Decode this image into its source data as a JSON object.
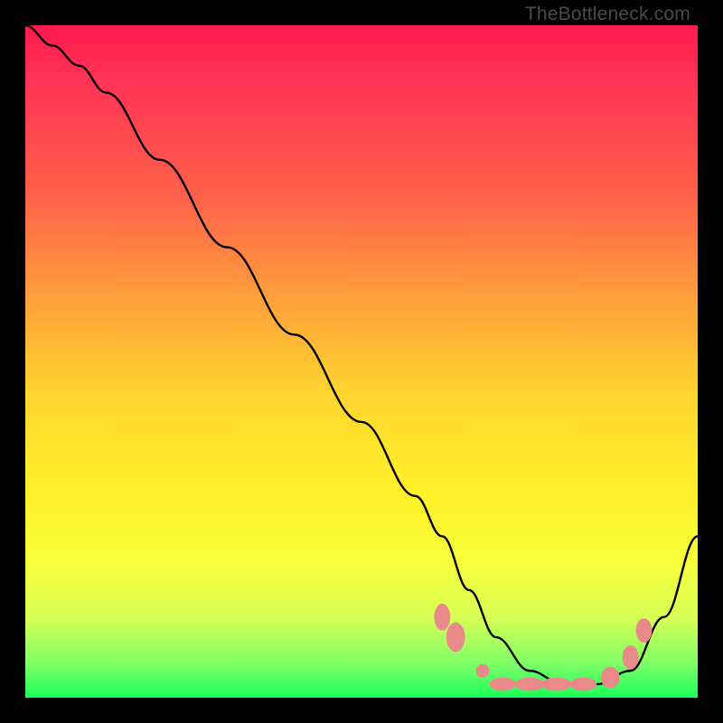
{
  "watermark": "TheBottleneck.com",
  "chart_data": {
    "type": "line",
    "title": "",
    "xlabel": "",
    "ylabel": "",
    "xlim": [
      0,
      100
    ],
    "ylim": [
      0,
      100
    ],
    "grid": false,
    "legend": false,
    "background": {
      "type": "vertical-gradient",
      "stops": [
        {
          "pos": 0,
          "color": "#ff1a4d"
        },
        {
          "pos": 25,
          "color": "#ff5f4a"
        },
        {
          "pos": 55,
          "color": "#ffd52e"
        },
        {
          "pos": 80,
          "color": "#f6ff3a"
        },
        {
          "pos": 100,
          "color": "#1aff5a"
        }
      ]
    },
    "series": [
      {
        "name": "curve",
        "color": "#000000",
        "x": [
          0,
          4,
          8,
          12,
          20,
          30,
          40,
          50,
          58,
          62,
          66,
          70,
          75,
          80,
          85,
          90,
          95,
          100
        ],
        "values": [
          100,
          97,
          94,
          90,
          80,
          67,
          54,
          41,
          30,
          24,
          16,
          9,
          4,
          2,
          2,
          4,
          12,
          24
        ]
      }
    ],
    "markers": [
      {
        "name": "dot-cluster",
        "color": "#e98a8a",
        "shape": "ellipse",
        "points": [
          {
            "x": 62,
            "y": 12,
            "rx": 1.2,
            "ry": 2.0
          },
          {
            "x": 64,
            "y": 9,
            "rx": 1.4,
            "ry": 2.2
          },
          {
            "x": 68,
            "y": 4,
            "rx": 1.0,
            "ry": 1.0
          },
          {
            "x": 71,
            "y": 2,
            "rx": 2.0,
            "ry": 1.0
          },
          {
            "x": 75,
            "y": 2,
            "rx": 2.2,
            "ry": 1.0
          },
          {
            "x": 79,
            "y": 2,
            "rx": 2.2,
            "ry": 1.0
          },
          {
            "x": 83,
            "y": 2,
            "rx": 2.0,
            "ry": 1.0
          },
          {
            "x": 87,
            "y": 3,
            "rx": 1.4,
            "ry": 1.6
          },
          {
            "x": 90,
            "y": 6,
            "rx": 1.2,
            "ry": 1.8
          },
          {
            "x": 92,
            "y": 10,
            "rx": 1.2,
            "ry": 1.8
          }
        ]
      }
    ]
  }
}
